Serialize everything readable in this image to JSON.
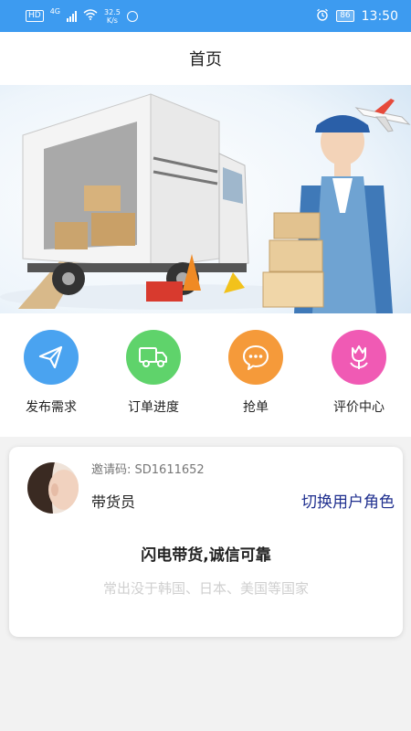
{
  "status_bar": {
    "hd": "HD",
    "network": "4G",
    "speed_value": "32.5",
    "speed_unit": "K/s",
    "battery": "86",
    "time": "13:50"
  },
  "header": {
    "title": "首页"
  },
  "menu": [
    {
      "label": "发布需求",
      "icon": "paper-plane-icon",
      "color": "#4aa3f0"
    },
    {
      "label": "订单进度",
      "icon": "truck-icon",
      "color": "#5fd36b"
    },
    {
      "label": "抢单",
      "icon": "chat-bubble-icon",
      "color": "#f59a3a"
    },
    {
      "label": "评价中心",
      "icon": "tulip-icon",
      "color": "#f05ab4"
    }
  ],
  "card": {
    "invite": "邀请码:  SD1611652",
    "role": "带货员",
    "switch_role": "切换用户角色",
    "slogan": "闪电带货,诚信可靠",
    "sub_slogan": "常出没于韩国、日本、美国等国家"
  },
  "colors": {
    "primary": "#3d9bf0",
    "switch_text": "#1f2f8f"
  }
}
